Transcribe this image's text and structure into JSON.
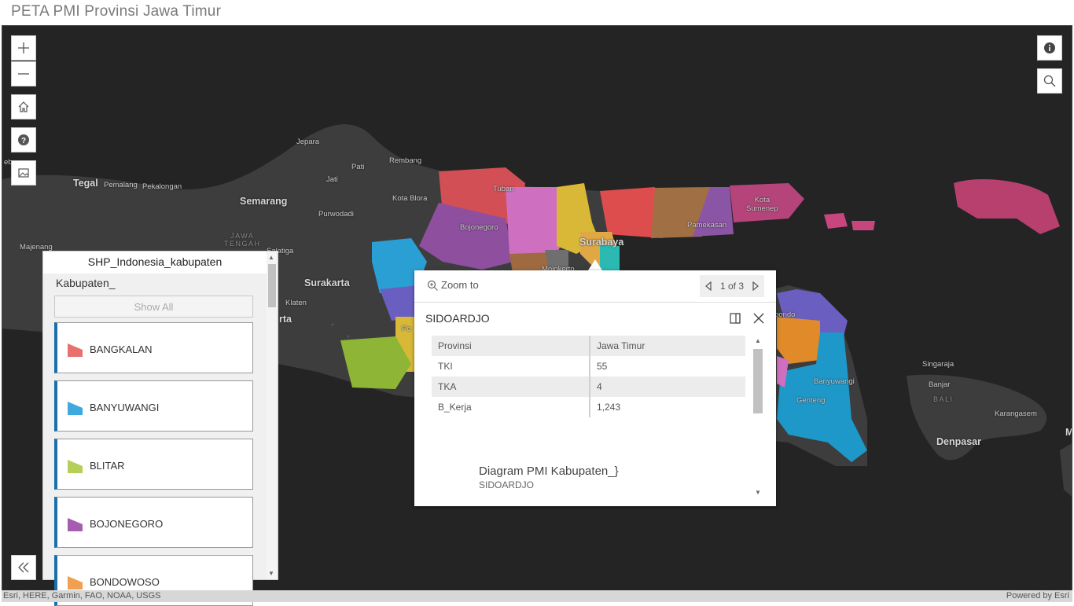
{
  "app": {
    "title": "PETA PMI Provinsi Jawa Timur"
  },
  "map": {
    "labels": {
      "jepara": "Jepara",
      "pati": "Pati",
      "rembang": "Rembang",
      "jati": "Jati",
      "tegal": "Tegal",
      "pemalang": "Pemalang",
      "pekalongan": "Pekalongan",
      "semarang": "Semarang",
      "purwodadi": "Purwodadi",
      "kota_blora": "Kota Blora",
      "tuban": "Tuban",
      "bojonegoro": "Bojonegoro",
      "surabaya": "Surabaya",
      "kota_sumenep": "Kota\nSumenep",
      "pamekasan": "Pamekasan",
      "jawa_tengah": "JAWA\nTENGAH",
      "majenang": "Majenang",
      "salatiga": "Salatiga",
      "surakarta": "Surakarta",
      "klaten": "Klaten",
      "rta": "rta",
      "eb": "eb",
      "mojokerto": "Mojokerto",
      "bondowoso_map": "bondo",
      "banyuwangi": "Banyuwangi",
      "genteng": "Genteng",
      "singaraja": "Singaraja",
      "banjar": "Banjar",
      "bali": "BALI",
      "karangasem": "Karangasem",
      "denpasar": "Denpasar",
      "m": "M",
      "po": "Po"
    }
  },
  "controls": {
    "zoom_in": "plus-icon",
    "zoom_out": "minus-icon",
    "home": "home-icon",
    "help": "help-icon",
    "basemap": "basemap-gallery-icon",
    "info": "info-icon",
    "search": "search-icon",
    "collapse": "double-chevron-left-icon"
  },
  "filter_panel": {
    "title": "SHP_Indonesia_kabupaten",
    "field": "Kabupaten_",
    "show_all": "Show All",
    "items": [
      {
        "name": "BANGKALAN",
        "color": "#e8706d"
      },
      {
        "name": "BANYUWANGI",
        "color": "#3ea9dc"
      },
      {
        "name": "BLITAR",
        "color": "#b5cf5a"
      },
      {
        "name": "BOJONEGORO",
        "color": "#a55db0"
      },
      {
        "name": "BONDOWOSO",
        "color": "#f0a050"
      }
    ]
  },
  "popup": {
    "zoom_to": "Zoom to",
    "pager": "1 of 3",
    "feature_title": "SIDOARDJO",
    "attributes": [
      {
        "key": "Provinsi",
        "value": "Jawa Timur"
      },
      {
        "key": "TKI",
        "value": "55"
      },
      {
        "key": "TKA",
        "value": "4"
      },
      {
        "key": "B_Kerja",
        "value": "1,243"
      }
    ],
    "chart_title": "Diagram PMI Kabupaten_}",
    "chart_subtitle": "SIDOARDJO"
  },
  "attribution": {
    "left": "Esri, HERE, Garmin, FAO, NOAA, USGS",
    "right": "Powered by Esri"
  }
}
